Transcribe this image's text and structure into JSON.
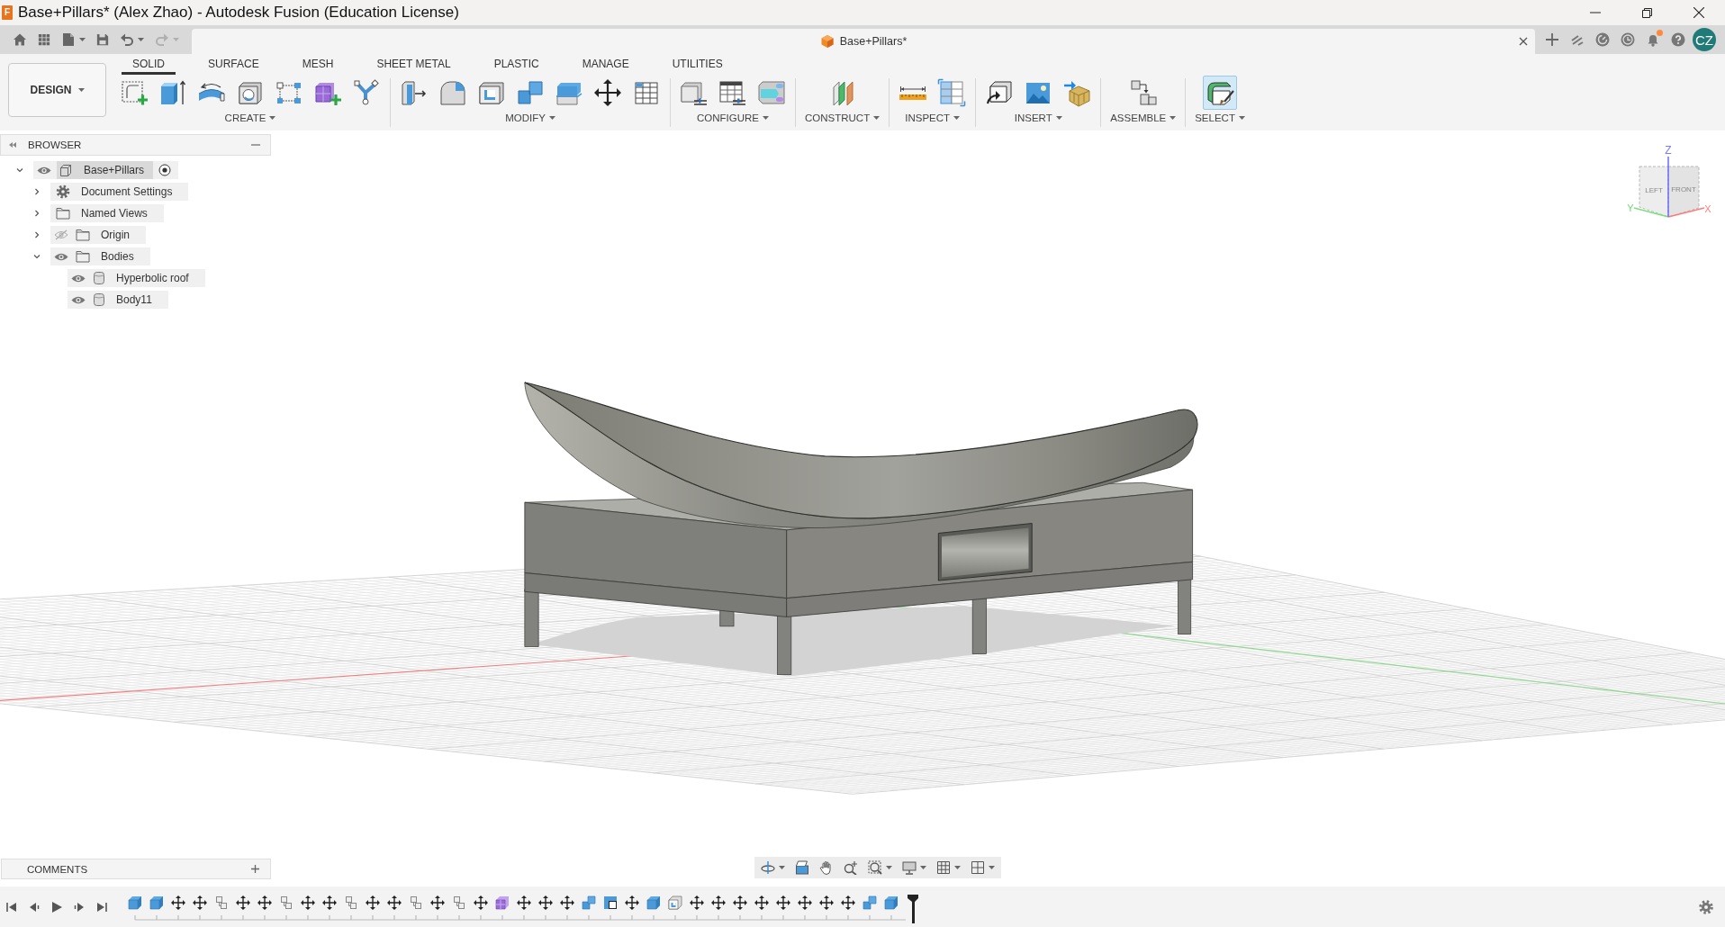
{
  "title_bar": {
    "app_icon": {
      "text": "F"
    },
    "title": "Base+Pillars* (Alex Zhao) - Autodesk Fusion (Education License)"
  },
  "quick_access": {
    "undo": {
      "disabled": false
    },
    "redo": {
      "disabled": true
    }
  },
  "document_tab": {
    "title": "Base+Pillars*"
  },
  "account": {
    "notifications_unread": true,
    "initials": "CZ"
  },
  "workspace_button": {
    "label": "DESIGN"
  },
  "toolbar_tabs": [
    {
      "label": "SOLID",
      "selected": true
    },
    {
      "label": "SURFACE",
      "selected": false
    },
    {
      "label": "MESH",
      "selected": false
    },
    {
      "label": "SHEET METAL",
      "selected": false
    },
    {
      "label": "PLASTIC",
      "selected": false
    },
    {
      "label": "MANAGE",
      "selected": false
    },
    {
      "label": "UTILITIES",
      "selected": false
    }
  ],
  "tool_groups": [
    {
      "label": "CREATE",
      "tools": [
        {
          "kind": "sketch"
        },
        {
          "kind": "extrude"
        },
        {
          "kind": "revolve"
        },
        {
          "kind": "hole"
        },
        {
          "kind": "pattern"
        },
        {
          "kind": "form"
        },
        {
          "kind": "branch"
        }
      ]
    },
    {
      "label": "MODIFY",
      "tools": [
        {
          "kind": "presspull"
        },
        {
          "kind": "fillet"
        },
        {
          "kind": "shell"
        },
        {
          "kind": "combine"
        },
        {
          "kind": "offset"
        },
        {
          "kind": "move"
        },
        {
          "kind": "table"
        }
      ]
    },
    {
      "label": "CONFIGURE",
      "tools": [
        {
          "kind": "cube_sliders"
        },
        {
          "kind": "table_sliders"
        },
        {
          "kind": "rules"
        }
      ]
    },
    {
      "label": "CONSTRUCT",
      "tools": [
        {
          "kind": "planes"
        }
      ]
    },
    {
      "label": "INSPECT",
      "tools": [
        {
          "kind": "ruler"
        },
        {
          "kind": "split_grid"
        }
      ]
    },
    {
      "label": "INSERT",
      "tools": [
        {
          "kind": "cube_arrow"
        },
        {
          "kind": "picture"
        },
        {
          "kind": "mesh"
        }
      ]
    },
    {
      "label": "ASSEMBLE",
      "tools": [
        {
          "kind": "cubes_arrow"
        }
      ]
    },
    {
      "label": "SELECT",
      "tools": [
        {
          "kind": "paint_select",
          "active": true
        }
      ]
    }
  ],
  "browser": {
    "title": "BROWSER",
    "tree": [
      {
        "label": "Base+Pillars",
        "kind": "component",
        "expanded": true,
        "visible": true,
        "active": true,
        "children": [
          {
            "label": "Document Settings",
            "kind": "settings",
            "expanded": false
          },
          {
            "label": "Named Views",
            "kind": "folder",
            "expanded": false
          },
          {
            "label": "Origin",
            "kind": "folder",
            "expanded": false,
            "visible": false
          },
          {
            "label": "Bodies",
            "kind": "folder",
            "expanded": true,
            "visible": true,
            "children": [
              {
                "label": "Hyperbolic roof",
                "kind": "body",
                "visible": true
              },
              {
                "label": "Body11",
                "kind": "body",
                "visible": true
              }
            ]
          }
        ]
      }
    ]
  },
  "view_cube": {
    "faces": [
      "LEFT",
      "FRONT"
    ],
    "axes": {
      "z": "Z",
      "y": "Y",
      "x": "X"
    }
  },
  "comments": {
    "title": "COMMENTS"
  },
  "timeline": {
    "features": [
      {
        "kind": "extrude"
      },
      {
        "kind": "extrude"
      },
      {
        "kind": "move"
      },
      {
        "kind": "move"
      },
      {
        "kind": "copy"
      },
      {
        "kind": "move"
      },
      {
        "kind": "move"
      },
      {
        "kind": "copy"
      },
      {
        "kind": "move"
      },
      {
        "kind": "move"
      },
      {
        "kind": "copy"
      },
      {
        "kind": "move"
      },
      {
        "kind": "move"
      },
      {
        "kind": "copy"
      },
      {
        "kind": "move"
      },
      {
        "kind": "copy"
      },
      {
        "kind": "move"
      },
      {
        "kind": "form"
      },
      {
        "kind": "move"
      },
      {
        "kind": "move"
      },
      {
        "kind": "move"
      },
      {
        "kind": "combine"
      },
      {
        "kind": "scale"
      },
      {
        "kind": "move"
      },
      {
        "kind": "extrude"
      },
      {
        "kind": "shell"
      },
      {
        "kind": "move"
      },
      {
        "kind": "move"
      },
      {
        "kind": "move"
      },
      {
        "kind": "move"
      },
      {
        "kind": "move"
      },
      {
        "kind": "move"
      },
      {
        "kind": "move"
      },
      {
        "kind": "move"
      },
      {
        "kind": "combine"
      },
      {
        "kind": "extrude"
      }
    ]
  }
}
